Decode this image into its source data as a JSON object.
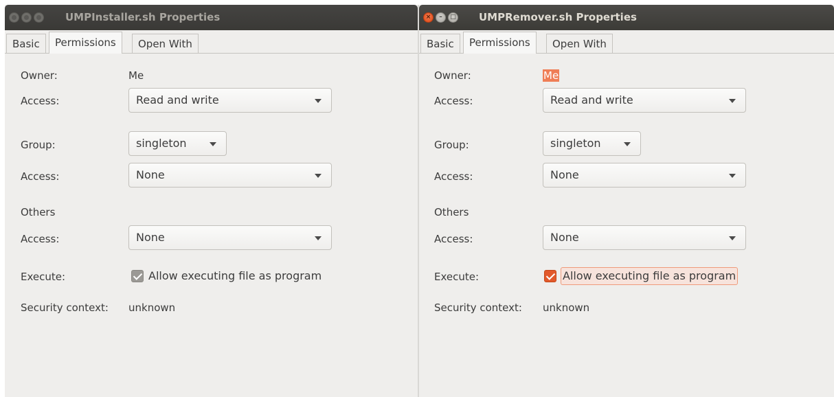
{
  "left_window": {
    "title": "UMPInstaller.sh Properties",
    "tabs": [
      "Basic",
      "Permissions",
      "Open With"
    ],
    "owner_label": "Owner:",
    "owner_value": "Me",
    "owner_access_label": "Access:",
    "owner_access_value": "Read and write",
    "group_label": "Group:",
    "group_value": "singleton",
    "group_access_label": "Access:",
    "group_access_value": "None",
    "others_label": "Others",
    "others_access_label": "Access:",
    "others_access_value": "None",
    "execute_label": "Execute:",
    "execute_checkbox_label": "Allow executing file as program",
    "execute_checked": true,
    "security_label": "Security context:",
    "security_value": "unknown"
  },
  "right_window": {
    "title": "UMPRemover.sh Properties",
    "tabs": [
      "Basic",
      "Permissions",
      "Open With"
    ],
    "owner_label": "Owner:",
    "owner_value": "Me",
    "owner_access_label": "Access:",
    "owner_access_value": "Read and write",
    "group_label": "Group:",
    "group_value": "singleton",
    "group_access_label": "Access:",
    "group_access_value": "None",
    "others_label": "Others",
    "others_access_label": "Access:",
    "others_access_value": "None",
    "execute_label": "Execute:",
    "execute_checkbox_label": "Allow executing file as program",
    "execute_checked": true,
    "security_label": "Security context:",
    "security_value": "unknown"
  },
  "colors": {
    "accent": "#e2592b",
    "titlebar": "#3c3b37",
    "window_bg": "#efeeec"
  }
}
